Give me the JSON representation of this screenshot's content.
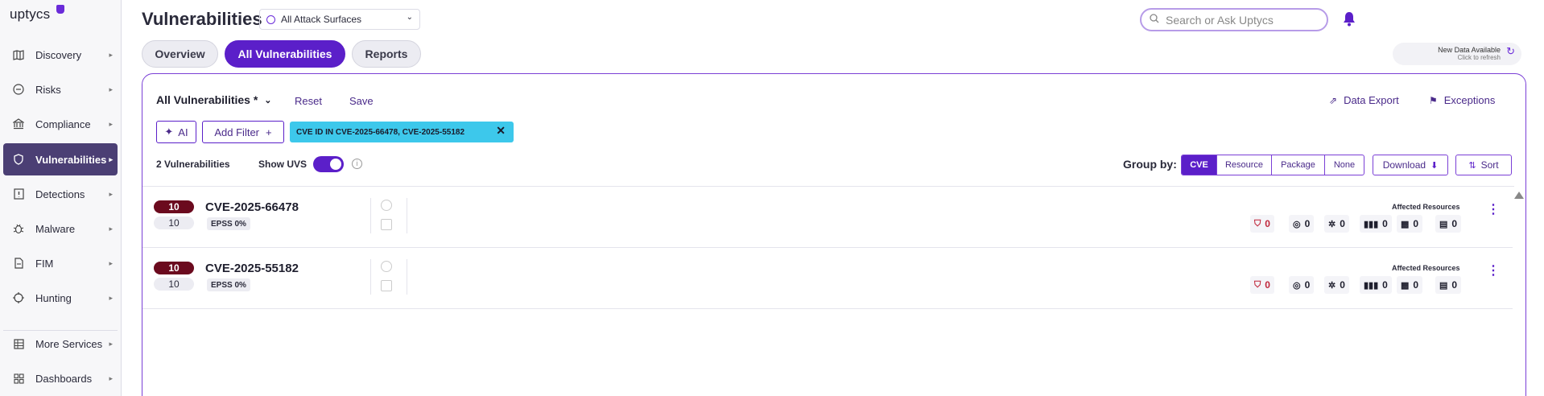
{
  "app": {
    "logo_text": "uptycs"
  },
  "sidebar": {
    "items": [
      {
        "label": "Discovery",
        "icon": "map-icon"
      },
      {
        "label": "Risks",
        "icon": "risk-icon"
      },
      {
        "label": "Compliance",
        "icon": "bank-icon"
      },
      {
        "label": "Vulnerabilities",
        "icon": "shield-icon",
        "active": true
      },
      {
        "label": "Detections",
        "icon": "alert-icon"
      },
      {
        "label": "Malware",
        "icon": "bug-icon"
      },
      {
        "label": "FIM",
        "icon": "file-icon"
      },
      {
        "label": "Hunting",
        "icon": "crosshair-icon"
      },
      {
        "label": "More Services",
        "icon": "grid-icon"
      },
      {
        "label": "Dashboards",
        "icon": "dashboard-icon"
      }
    ]
  },
  "header": {
    "title": "Vulnerabilities",
    "surface_select": "All Attack Surfaces",
    "search_placeholder": "Search or Ask Uptycs",
    "tabs": [
      {
        "label": "Overview"
      },
      {
        "label": "All Vulnerabilities",
        "active": true
      },
      {
        "label": "Reports"
      }
    ],
    "new_data": {
      "title": "New Data Available",
      "subtitle": "Click to refresh"
    }
  },
  "toolbar": {
    "view_name": "All Vulnerabilities *",
    "reset_label": "Reset",
    "save_label": "Save",
    "export_label": "Data Export",
    "exceptions_label": "Exceptions",
    "ai_label": "AI",
    "add_filter_label": "Add Filter",
    "filter_chip": "CVE ID IN CVE-2025-66478, CVE-2025-55182",
    "count_label": "2 Vulnerabilities",
    "uvs_label": "Show UVS",
    "uvs_on": true,
    "group_by_label": "Group by:",
    "group_options": [
      "CVE",
      "Resource",
      "Package",
      "None"
    ],
    "group_selected": "CVE",
    "download_label": "Download",
    "sort_label": "Sort"
  },
  "rows": [
    {
      "score": "10",
      "uvs": "10",
      "cve": "CVE-2025-66478",
      "epss": "EPSS 0%",
      "affected_label": "Affected Resources",
      "metrics": [
        "0",
        "0",
        "0",
        "0",
        "0",
        "0"
      ]
    },
    {
      "score": "10",
      "uvs": "10",
      "cve": "CVE-2025-55182",
      "epss": "EPSS 0%",
      "affected_label": "Affected Resources",
      "metrics": [
        "0",
        "0",
        "0",
        "0",
        "0",
        "0"
      ]
    }
  ],
  "colors": {
    "accent": "#5b1fc9",
    "active_nav": "#4b3f74",
    "chip": "#3dc8eb",
    "score": "#6b0a1e"
  }
}
